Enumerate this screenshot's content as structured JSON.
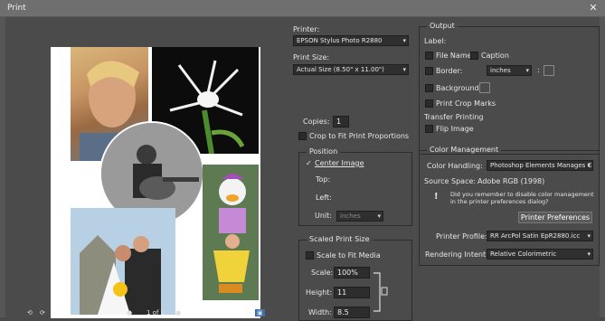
{
  "window": {
    "title": "Print",
    "close_glyph": "✕"
  },
  "printer": {
    "label": "Printer:",
    "value": "EPSON Stylus Photo R2880",
    "print_size_label": "Print Size:",
    "print_size_value": "Actual Size (8.50\" x 11.00\")",
    "copies_label": "Copies:",
    "copies_value": "1",
    "crop_label": "Crop to Fit Print Proportions"
  },
  "position": {
    "title": "Position",
    "center_label": "Center Image",
    "top_label": "Top:",
    "left_label": "Left:",
    "unit_label": "Unit:",
    "unit_value": "inches"
  },
  "scaled": {
    "title": "Scaled Print Size",
    "fit_label": "Scale to Fit Media",
    "scale_label": "Scale:",
    "scale_value": "100%",
    "height_label": "Height:",
    "height_value": "11",
    "width_label": "Width:",
    "width_value": "8.5"
  },
  "output": {
    "title": "Output",
    "label_heading": "Label:",
    "file_name": "File Name",
    "caption": "Caption",
    "border": "Border:",
    "border_unit": "inches",
    "colon": ":",
    "background": "Background:",
    "crop_marks": "Print Crop Marks",
    "transfer_heading": "Transfer Printing",
    "flip_image": "Flip Image"
  },
  "color_mgmt": {
    "title": "Color Management",
    "handling_label": "Color Handling:",
    "handling_value": "Photoshop Elements Manages Col",
    "source_space": "Source Space:",
    "source_value": "Adobe RGB (1998)",
    "warning": "Did you remember to disable color management in the printer preferences dialog?",
    "prefs_button": "Printer Preferences",
    "profile_label": "Printer Profile:",
    "profile_value": "RR ArcPol Satin EpR2880.icc",
    "intent_label": "Rendering Intent:",
    "intent_value": "Relative Colorimetric"
  },
  "footer": {
    "page_text": "1 of 1"
  },
  "colors": {
    "window_bg": "#4b4b4b",
    "titlebar": "#6f6f6f",
    "paper": "#ffffff"
  }
}
